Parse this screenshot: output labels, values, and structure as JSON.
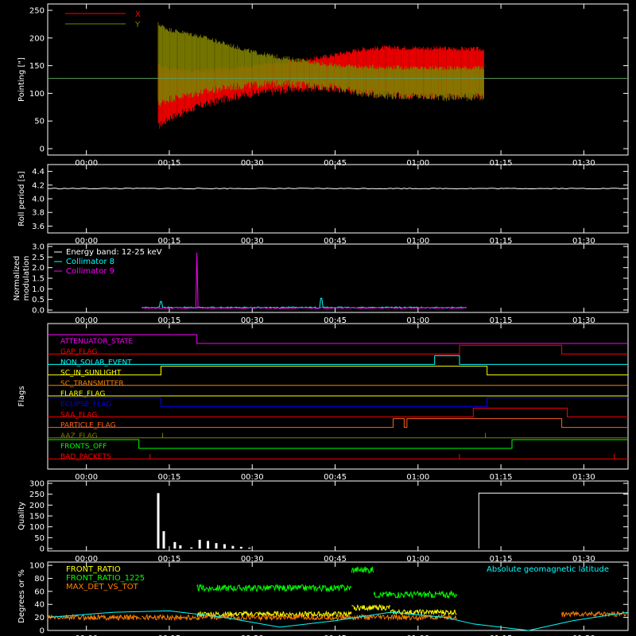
{
  "chart_data": [
    {
      "type": "line",
      "ylabel": "Pointing [\"]",
      "ylim": [
        0,
        250
      ],
      "yticks": [
        0,
        50,
        100,
        150,
        200,
        250
      ],
      "xticks": [
        "00:00",
        "00:15",
        "00:30",
        "00:45",
        "01:00",
        "01:15",
        "01:30"
      ],
      "x_range_minutes": [
        -7,
        98
      ],
      "hline": 127,
      "hline_color": "#5d9e5d",
      "series": [
        {
          "name": "X",
          "color": "#ff0000",
          "x": [
            13,
            15,
            20,
            25,
            30,
            35,
            40,
            45,
            50,
            55,
            60,
            65,
            70,
            72
          ],
          "low": [
            40,
            55,
            75,
            90,
            100,
            105,
            110,
            108,
            102,
            98,
            96,
            96,
            96,
            96
          ],
          "high": [
            150,
            145,
            140,
            145,
            150,
            155,
            160,
            170,
            180,
            183,
            182,
            181,
            180,
            180
          ]
        },
        {
          "name": "Y",
          "color": "#808000",
          "x": [
            13,
            15,
            20,
            25,
            30,
            35,
            40,
            45,
            50,
            55,
            60,
            65,
            70,
            72
          ],
          "low": [
            80,
            90,
            100,
            110,
            115,
            118,
            115,
            110,
            100,
            96,
            94,
            93,
            93,
            93
          ],
          "high": [
            225,
            215,
            205,
            190,
            175,
            165,
            158,
            150,
            148,
            147,
            146,
            146,
            146,
            146
          ]
        }
      ]
    },
    {
      "type": "line",
      "ylabel": "Roll period [s]",
      "ylim": [
        3.5,
        4.5
      ],
      "yticks": [
        "3.6",
        "3.8",
        "4.0",
        "4.2",
        "4.4"
      ],
      "xticks": [
        "00:00",
        "00:15",
        "00:30",
        "00:45",
        "01:00",
        "01:15",
        "01:30"
      ],
      "series": [
        {
          "name": "roll",
          "color": "#ffffff",
          "x": [
            -7,
            98
          ],
          "y": [
            4.15,
            4.15
          ]
        }
      ]
    },
    {
      "type": "line",
      "ylabel": [
        "Normalized",
        "modulation"
      ],
      "ylim": [
        0,
        3
      ],
      "yticks": [
        "0.0",
        "0.5",
        "1.0",
        "1.5",
        "2.0",
        "2.5",
        "3.0"
      ],
      "xticks": [
        "00:00",
        "00:15",
        "00:30",
        "00:45",
        "01:00",
        "01:15",
        "01:30"
      ],
      "legend_title": "Energy band: 12-25 keV",
      "series": [
        {
          "name": "Collimator 8",
          "color": "#00ffff",
          "x": [
            10,
            30,
            50,
            69
          ],
          "baseline": 0.12,
          "spikes": [
            [
              13.5,
              0.4
            ],
            [
              42.5,
              0.55
            ],
            [
              69,
              0.45
            ]
          ]
        },
        {
          "name": "Collimator 9",
          "color": "#ff00ff",
          "x": [
            10,
            30,
            50,
            69
          ],
          "baseline": 0.1,
          "spikes": [
            [
              20,
              2.7
            ],
            [
              69,
              0.3
            ]
          ]
        }
      ]
    },
    {
      "type": "table",
      "ylabel": "Flags",
      "xticks": [
        "00:00",
        "00:15",
        "00:30",
        "00:45",
        "01:00",
        "01:15",
        "01:30"
      ],
      "flags": [
        {
          "name": "ATTENUATOR_STATE",
          "color": "#ff00ff",
          "segments": [
            [
              -7,
              20,
              1
            ],
            [
              20,
              98,
              0
            ]
          ]
        },
        {
          "name": "GAP_FLAG",
          "color": "#ff0000",
          "segments": [
            [
              -7,
              67.5,
              0
            ],
            [
              67.5,
              86,
              1
            ],
            [
              86,
              98,
              0
            ]
          ]
        },
        {
          "name": "NON_SOLAR_EVENT",
          "color": "#00ffff",
          "segments": [
            [
              -7,
              63,
              0
            ],
            [
              63,
              67.5,
              1
            ],
            [
              67.5,
              98,
              0
            ]
          ]
        },
        {
          "name": "SC_IN_SUNLIGHT",
          "color": "#ffff00",
          "segments": [
            [
              -7,
              13.5,
              0
            ],
            [
              13.5,
              72.5,
              1
            ],
            [
              72.5,
              98,
              0
            ]
          ]
        },
        {
          "name": "SC_TRANSMITTER",
          "color": "#ff8000",
          "segments": [
            [
              -7,
              98,
              0
            ]
          ]
        },
        {
          "name": "FLARE_FLAG",
          "color": "#ffff00",
          "segments": [
            [
              -7,
              98,
              0
            ]
          ]
        },
        {
          "name": "ECLIPSE_FLAG",
          "color": "#0000ff",
          "segments": [
            [
              -7,
              13.5,
              1
            ],
            [
              13.5,
              72.5,
              0
            ],
            [
              72.5,
              98,
              1
            ]
          ]
        },
        {
          "name": "SAA_FLAG",
          "color": "#ff0000",
          "segments": [
            [
              -7,
              70,
              0
            ],
            [
              70,
              87,
              1
            ],
            [
              87,
              98,
              0
            ]
          ]
        },
        {
          "name": "PARTICLE_FLAG",
          "color": "#ff6020",
          "segments": [
            [
              -7,
              55.5,
              0
            ],
            [
              55.5,
              57.5,
              1
            ],
            [
              57.5,
              58,
              0
            ],
            [
              58,
              86,
              1
            ],
            [
              86,
              98,
              0
            ]
          ]
        },
        {
          "name": "AAZ_FLAG",
          "color": "#808000",
          "segments": [
            [
              -7,
              98,
              0
            ]
          ],
          "blips": [
            13.8,
            72.2
          ]
        },
        {
          "name": "FRONTS_OFF",
          "color": "#00ff00",
          "segments": [
            [
              -7,
              9.5,
              1
            ],
            [
              9.5,
              77,
              0
            ],
            [
              77,
              98,
              1
            ]
          ]
        },
        {
          "name": "BAD_PACKETS",
          "color": "#ff0000",
          "segments": [
            [
              -7,
              98,
              0
            ]
          ],
          "blips": [
            11.5,
            67.5,
            95.5
          ]
        }
      ]
    },
    {
      "type": "bar",
      "ylabel": "Quality",
      "ylim": [
        0,
        300
      ],
      "yticks": [
        0,
        50,
        100,
        150,
        200,
        250,
        300
      ],
      "xticks": [
        "00:00",
        "00:15",
        "00:30",
        "00:45",
        "01:00",
        "01:15",
        "01:30"
      ],
      "series": [
        {
          "name": "quality",
          "color": "#ffffff",
          "x": [
            13,
            14,
            16,
            17,
            19,
            20.5,
            22,
            23.5,
            25,
            26.5,
            28,
            29.5
          ],
          "y": [
            255,
            80,
            30,
            15,
            5,
            40,
            35,
            25,
            20,
            12,
            8,
            4
          ],
          "high_from": 71,
          "high_value": 255
        }
      ]
    },
    {
      "type": "line",
      "ylabel": "Degrees or %",
      "ylim": [
        0,
        105
      ],
      "yticks": [
        0,
        20,
        40,
        60,
        80,
        100
      ],
      "xticks": [
        "00:00",
        "00:15",
        "00:30",
        "00:45",
        "01:00",
        "01:15",
        "01:30"
      ],
      "legend_right": "Absolute geomagnetic latitude",
      "series": [
        {
          "name": "FRONT_RATIO",
          "color": "#ffff00",
          "segments": [
            [
              20,
              48,
              25
            ],
            [
              48,
              55,
              35
            ],
            [
              55,
              67,
              28
            ]
          ]
        },
        {
          "name": "FRONT_RATIO_1225",
          "color": "#00ff00",
          "segments": [
            [
              20,
              48,
              65
            ],
            [
              48,
              52,
              93
            ],
            [
              52,
              67,
              55
            ]
          ]
        },
        {
          "name": "MAX_DET_VS_TOT",
          "color": "#ff8000",
          "segments": [
            [
              -7,
              10,
              20
            ],
            [
              10,
              67,
              20
            ],
            [
              86,
              98,
              25
            ]
          ]
        },
        {
          "name": "Absolute geomagnetic latitude",
          "color": "#00ffff",
          "x": [
            -7,
            5,
            15,
            25,
            35,
            45,
            55,
            65,
            70,
            80,
            88,
            98
          ],
          "y": [
            20,
            28,
            30,
            20,
            5,
            15,
            28,
            20,
            10,
            0,
            15,
            28
          ]
        }
      ]
    }
  ]
}
